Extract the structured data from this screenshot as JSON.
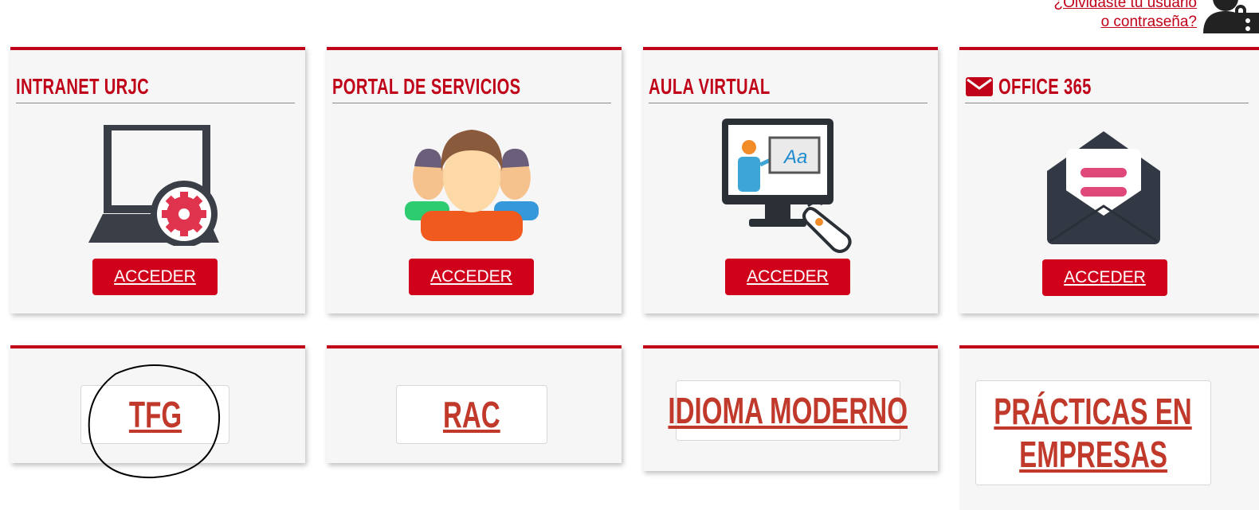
{
  "header": {
    "forgot_line1": "¿Olvidaste tu usuario",
    "forgot_line2": "o contraseña?"
  },
  "cards": [
    {
      "title": "Intranet URJC",
      "icon": "laptop-gear-icon",
      "button": "ACCEDER"
    },
    {
      "title": "Portal de servicios",
      "icon": "people-group-icon",
      "button": "ACCEDER"
    },
    {
      "title": "Aula Virtual",
      "icon": "monitor-teacher-icon",
      "button": "ACCEDER"
    },
    {
      "title": "Office 365",
      "title_icon": "envelope-icon",
      "icon": "open-envelope-icon",
      "button": "ACCEDER"
    }
  ],
  "quick_links": [
    {
      "label": "TFG"
    },
    {
      "label": "RAC"
    },
    {
      "label": "Idioma moderno"
    },
    {
      "label_line1": "Prácticas en",
      "label_line2": "empresas"
    }
  ],
  "colors": {
    "accent": "#c00018",
    "button": "#d0021b",
    "card_bg": "#f6f6f6"
  }
}
